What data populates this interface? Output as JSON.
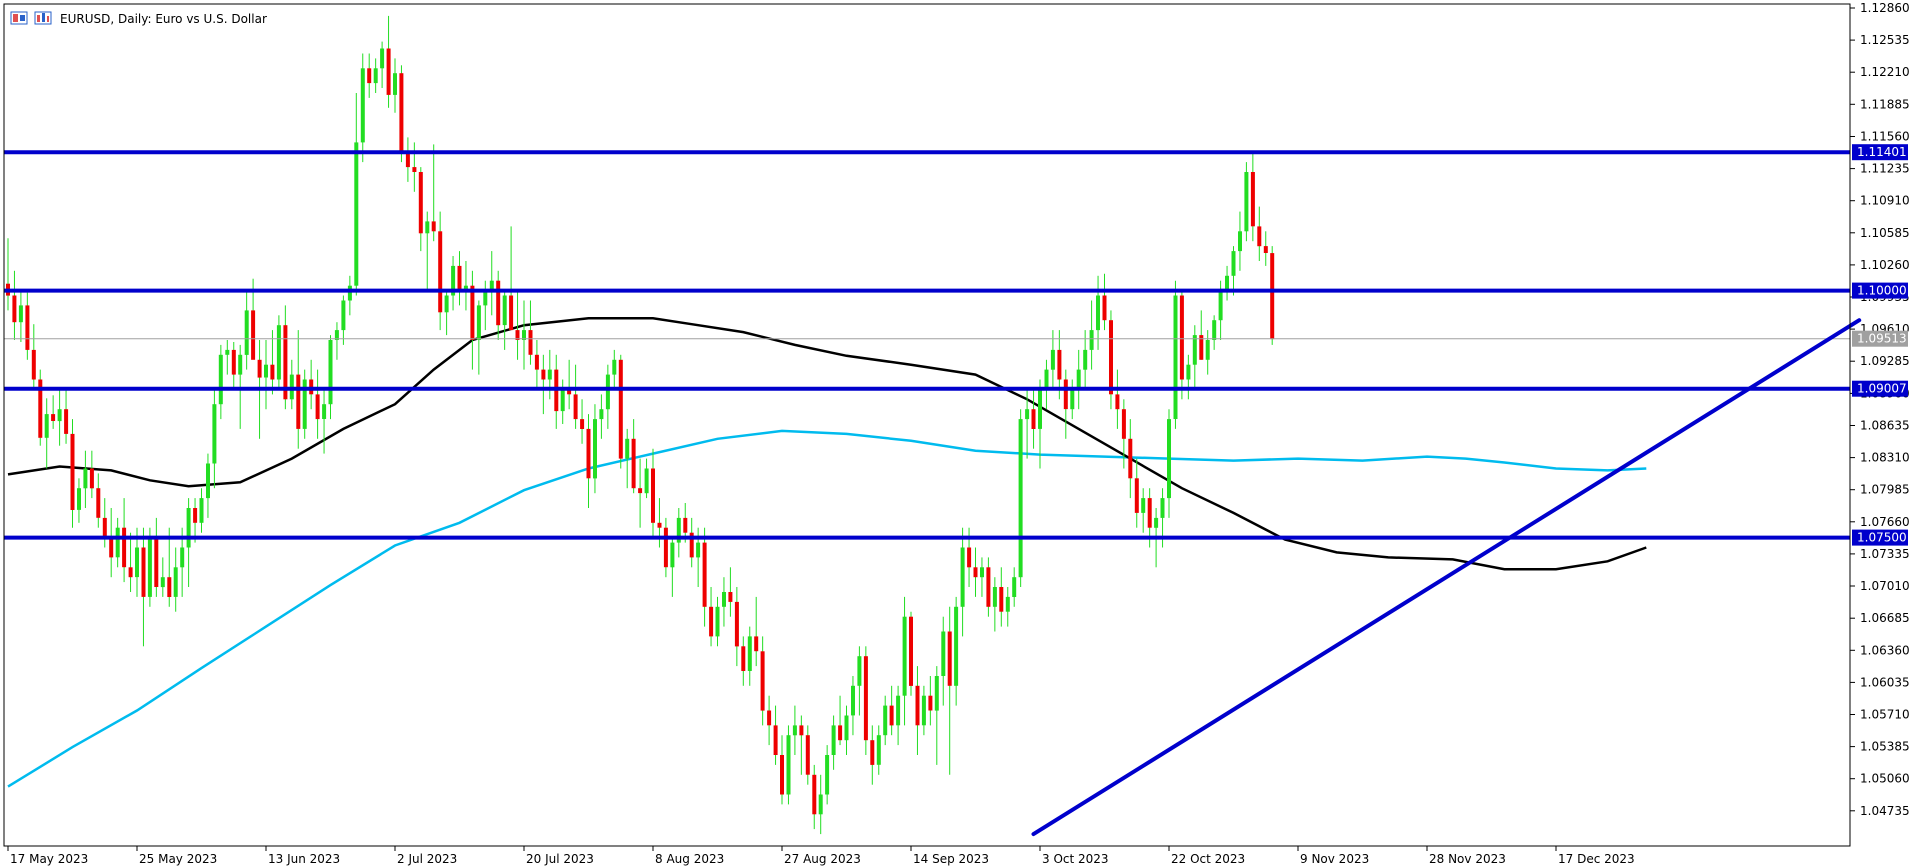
{
  "header": {
    "title": "EURUSD, Daily:  Euro vs U.S. Dollar",
    "icons": [
      "candles-toggle-icon",
      "chart-type-icon"
    ]
  },
  "colors": {
    "bull": "#22dd22",
    "bear": "#ee0000",
    "wick": "#22dd22",
    "level_line": "#0000cc",
    "trend_line": "#0000cc",
    "ma_black": "#000000",
    "ma_blue": "#00bbee",
    "grid_frame": "#000000",
    "current_price_line": "#a0a0a0",
    "current_price_label_bg": "#a0a0a0"
  },
  "chart_data": {
    "type": "candlestick",
    "symbol": "EURUSD",
    "timeframe": "Daily",
    "title": "EURUSD, Daily:  Euro vs U.S. Dollar",
    "ylim": [
      1.0445,
      1.1286
    ],
    "y_ticks": [
      "1.12860",
      "1.12535",
      "1.12210",
      "1.11885",
      "1.11560",
      "1.11235",
      "1.10910",
      "1.10585",
      "1.10260",
      "1.09935",
      "1.09610",
      "1.09285",
      "1.08960",
      "1.08635",
      "1.08310",
      "1.07985",
      "1.07660",
      "1.07335",
      "1.07010",
      "1.06685",
      "1.06360",
      "1.06035",
      "1.05710",
      "1.05385",
      "1.05060",
      "1.04735"
    ],
    "x_ticks": [
      "17 May 2023",
      "25 May 2023",
      "13 Jun 2023",
      "2 Jul 2023",
      "20 Jul 2023",
      "8 Aug 2023",
      "27 Aug 2023",
      "14 Sep 2023",
      "3 Oct 2023",
      "22 Oct 2023",
      "9 Nov 2023",
      "28 Nov 2023",
      "17 Dec 2023"
    ],
    "x_tick_index": [
      0,
      20,
      40,
      60,
      80,
      100,
      120,
      140,
      160,
      180,
      200,
      220,
      240
    ],
    "levels": [
      {
        "value": 1.11401,
        "label": "1.11401"
      },
      {
        "value": 1.1,
        "label": "1.10000"
      },
      {
        "value": 1.09007,
        "label": "1.09007"
      },
      {
        "value": 1.075,
        "label": "1.07500"
      }
    ],
    "current_price": {
      "value": 1.09513,
      "label": "1.09513"
    },
    "trend_line": {
      "from": {
        "index": 159,
        "value": 1.045
      },
      "to": {
        "index": 287,
        "value": 1.097
      }
    },
    "ma_black": [
      [
        0,
        1.0814
      ],
      [
        8,
        1.0822
      ],
      [
        16,
        1.0818
      ],
      [
        22,
        1.0808
      ],
      [
        28,
        1.0802
      ],
      [
        36,
        1.0806
      ],
      [
        44,
        1.083
      ],
      [
        52,
        1.086
      ],
      [
        60,
        1.0885
      ],
      [
        66,
        1.092
      ],
      [
        72,
        1.095
      ],
      [
        80,
        1.0965
      ],
      [
        90,
        1.0972
      ],
      [
        100,
        1.0972
      ],
      [
        106,
        1.0966
      ],
      [
        114,
        1.0958
      ],
      [
        122,
        1.0945
      ],
      [
        130,
        1.0934
      ],
      [
        140,
        1.0925
      ],
      [
        150,
        1.0915
      ],
      [
        158,
        1.089
      ],
      [
        166,
        1.086
      ],
      [
        174,
        1.083
      ],
      [
        182,
        1.08
      ],
      [
        190,
        1.0775
      ],
      [
        198,
        1.0748
      ],
      [
        206,
        1.0735
      ],
      [
        214,
        1.073
      ],
      [
        224,
        1.0728
      ],
      [
        232,
        1.0718
      ],
      [
        240,
        1.0718
      ],
      [
        248,
        1.0726
      ],
      [
        254,
        1.074
      ]
    ],
    "ma_blue": [
      [
        0,
        1.0498
      ],
      [
        10,
        1.0538
      ],
      [
        20,
        1.0575
      ],
      [
        30,
        1.0618
      ],
      [
        40,
        1.066
      ],
      [
        50,
        1.0702
      ],
      [
        60,
        1.0742
      ],
      [
        70,
        1.0765
      ],
      [
        80,
        1.0798
      ],
      [
        90,
        1.082
      ],
      [
        100,
        1.0835
      ],
      [
        110,
        1.085
      ],
      [
        120,
        1.0858
      ],
      [
        130,
        1.0855
      ],
      [
        140,
        1.0848
      ],
      [
        150,
        1.0838
      ],
      [
        160,
        1.0834
      ],
      [
        170,
        1.0832
      ],
      [
        180,
        1.083
      ],
      [
        190,
        1.0828
      ],
      [
        200,
        1.083
      ],
      [
        210,
        1.0828
      ],
      [
        220,
        1.0832
      ],
      [
        226,
        1.083
      ],
      [
        232,
        1.0826
      ],
      [
        240,
        1.082
      ],
      [
        248,
        1.0818
      ],
      [
        254,
        1.082
      ]
    ],
    "ohlc": [
      [
        1.1007,
        1.1053,
        1.098,
        1.0995
      ],
      [
        1.0995,
        1.102,
        1.095,
        1.0968
      ],
      [
        1.0968,
        1.1,
        1.0948,
        1.0985
      ],
      [
        1.0985,
        1.0998,
        1.093,
        1.094
      ],
      [
        1.094,
        1.0966,
        1.09,
        1.091
      ],
      [
        1.091,
        1.092,
        1.0843,
        1.0851
      ],
      [
        1.0851,
        1.0891,
        1.082,
        1.0875
      ],
      [
        1.0875,
        1.0894,
        1.086,
        1.0868
      ],
      [
        1.0868,
        1.09,
        1.0843,
        1.088
      ],
      [
        1.088,
        1.09,
        1.0845,
        1.0855
      ],
      [
        1.0855,
        1.087,
        1.076,
        1.0778
      ],
      [
        1.0778,
        1.081,
        1.0765,
        1.08
      ],
      [
        1.08,
        1.0838,
        1.078,
        1.082
      ],
      [
        1.082,
        1.0838,
        1.079,
        1.08
      ],
      [
        1.08,
        1.0815,
        1.076,
        1.077
      ],
      [
        1.077,
        1.079,
        1.074,
        1.075
      ],
      [
        1.075,
        1.078,
        1.071,
        1.073
      ],
      [
        1.073,
        1.077,
        1.072,
        1.076
      ],
      [
        1.076,
        1.079,
        1.0705,
        1.072
      ],
      [
        1.072,
        1.0755,
        1.0695,
        1.071
      ],
      [
        1.071,
        1.076,
        1.069,
        1.074
      ],
      [
        1.074,
        1.076,
        1.064,
        1.069
      ],
      [
        1.069,
        1.076,
        1.068,
        1.075
      ],
      [
        1.075,
        1.077,
        1.069,
        1.07
      ],
      [
        1.07,
        1.073,
        1.069,
        1.071
      ],
      [
        1.071,
        1.076,
        1.068,
        1.069
      ],
      [
        1.069,
        1.074,
        1.0675,
        1.072
      ],
      [
        1.072,
        1.076,
        1.069,
        1.074
      ],
      [
        1.074,
        1.079,
        1.07,
        1.078
      ],
      [
        1.078,
        1.079,
        1.0745,
        1.0765
      ],
      [
        1.0765,
        1.08,
        1.0755,
        1.079
      ],
      [
        1.079,
        1.0835,
        1.077,
        1.0825
      ],
      [
        1.0825,
        1.09,
        1.08,
        1.0885
      ],
      [
        1.0885,
        1.0945,
        1.087,
        1.0935
      ],
      [
        1.0935,
        1.095,
        1.0915,
        1.094
      ],
      [
        1.094,
        1.0948,
        1.09,
        1.0915
      ],
      [
        1.0915,
        1.0945,
        1.086,
        1.0935
      ],
      [
        1.0935,
        1.1,
        1.092,
        1.098
      ],
      [
        1.098,
        1.1012,
        1.095,
        1.093
      ],
      [
        1.093,
        1.095,
        1.085,
        1.0912
      ],
      [
        1.0912,
        1.095,
        1.088,
        1.0925
      ],
      [
        1.0925,
        1.096,
        1.0895,
        1.091
      ],
      [
        1.091,
        1.0975,
        1.09,
        1.0965
      ],
      [
        1.0965,
        1.0985,
        1.088,
        1.089
      ],
      [
        1.089,
        1.093,
        1.088,
        1.0915
      ],
      [
        1.0915,
        1.096,
        1.084,
        1.086
      ],
      [
        1.086,
        1.092,
        1.085,
        1.091
      ],
      [
        1.091,
        1.093,
        1.088,
        1.0895
      ],
      [
        1.0895,
        1.092,
        1.085,
        1.087
      ],
      [
        1.087,
        1.09,
        1.0835,
        1.0885
      ],
      [
        1.0885,
        1.0955,
        1.087,
        1.095
      ],
      [
        1.095,
        1.0968,
        1.093,
        1.096
      ],
      [
        1.096,
        1.0995,
        1.0945,
        1.099
      ],
      [
        1.099,
        1.1015,
        1.0975,
        1.1005
      ],
      [
        1.1005,
        1.12,
        1.0995,
        1.115
      ],
      [
        1.115,
        1.124,
        1.113,
        1.1225
      ],
      [
        1.1225,
        1.124,
        1.1195,
        1.121
      ],
      [
        1.121,
        1.1235,
        1.12,
        1.1225
      ],
      [
        1.1225,
        1.1252,
        1.1205,
        1.1245
      ],
      [
        1.1245,
        1.1278,
        1.1185,
        1.1198
      ],
      [
        1.1198,
        1.1235,
        1.118,
        1.122
      ],
      [
        1.122,
        1.1228,
        1.113,
        1.114
      ],
      [
        1.114,
        1.1155,
        1.111,
        1.1125
      ],
      [
        1.1125,
        1.115,
        1.11,
        1.112
      ],
      [
        1.112,
        1.1125,
        1.104,
        1.1058
      ],
      [
        1.1058,
        1.108,
        1.1,
        1.107
      ],
      [
        1.107,
        1.1148,
        1.105,
        1.106
      ],
      [
        1.106,
        1.108,
        1.096,
        1.0978
      ],
      [
        1.0978,
        1.1,
        1.0955,
        1.0995
      ],
      [
        1.0995,
        1.1035,
        1.098,
        1.1025
      ],
      [
        1.1025,
        1.104,
        1.0985,
        1.1
      ],
      [
        1.1,
        1.103,
        1.098,
        1.1005
      ],
      [
        1.1005,
        1.102,
        1.092,
        1.095
      ],
      [
        1.095,
        1.099,
        1.0915,
        1.0985
      ],
      [
        1.0985,
        1.101,
        1.096,
        1.1
      ],
      [
        1.1,
        1.104,
        1.0975,
        1.101
      ],
      [
        1.101,
        1.102,
        1.095,
        1.0965
      ],
      [
        1.0965,
        1.1,
        1.094,
        1.0995
      ],
      [
        1.0995,
        1.1065,
        1.096,
        1.096
      ],
      [
        1.096,
        1.1,
        1.093,
        1.095
      ],
      [
        1.095,
        1.099,
        1.092,
        1.096
      ],
      [
        1.096,
        1.099,
        1.0925,
        1.0935
      ],
      [
        1.0935,
        1.095,
        1.09,
        1.092
      ],
      [
        1.092,
        1.0935,
        1.0875,
        1.091
      ],
      [
        1.091,
        1.094,
        1.089,
        1.092
      ],
      [
        1.092,
        1.0935,
        1.086,
        1.0878
      ],
      [
        1.0878,
        1.091,
        1.0865,
        1.09
      ],
      [
        1.09,
        1.093,
        1.088,
        1.0895
      ],
      [
        1.0895,
        1.0925,
        1.086,
        1.087
      ],
      [
        1.087,
        1.089,
        1.0845,
        1.086
      ],
      [
        1.086,
        1.0875,
        1.078,
        1.081
      ],
      [
        1.081,
        1.0885,
        1.0795,
        1.087
      ],
      [
        1.087,
        1.0895,
        1.085,
        1.088
      ],
      [
        1.088,
        1.0925,
        1.086,
        1.0915
      ],
      [
        1.0915,
        1.094,
        1.09,
        1.093
      ],
      [
        1.093,
        1.0935,
        1.082,
        1.083
      ],
      [
        1.083,
        1.086,
        1.08,
        1.085
      ],
      [
        1.085,
        1.087,
        1.0795,
        1.08
      ],
      [
        1.08,
        1.083,
        1.076,
        1.0795
      ],
      [
        1.0795,
        1.083,
        1.079,
        1.082
      ],
      [
        1.082,
        1.084,
        1.075,
        1.0765
      ],
      [
        1.0765,
        1.079,
        1.074,
        1.076
      ],
      [
        1.076,
        1.077,
        1.071,
        1.072
      ],
      [
        1.072,
        1.075,
        1.069,
        1.0745
      ],
      [
        1.0745,
        1.078,
        1.073,
        1.077
      ],
      [
        1.077,
        1.0785,
        1.0745,
        1.0755
      ],
      [
        1.0755,
        1.077,
        1.072,
        1.073
      ],
      [
        1.073,
        1.076,
        1.07,
        1.0745
      ],
      [
        1.0745,
        1.076,
        1.066,
        1.068
      ],
      [
        1.068,
        1.07,
        1.064,
        1.065
      ],
      [
        1.065,
        1.069,
        1.064,
        1.068
      ],
      [
        1.068,
        1.071,
        1.066,
        1.0695
      ],
      [
        1.0695,
        1.072,
        1.067,
        1.0685
      ],
      [
        1.0685,
        1.07,
        1.062,
        1.064
      ],
      [
        1.064,
        1.065,
        1.06,
        1.0615
      ],
      [
        1.0615,
        1.066,
        1.06,
        1.065
      ],
      [
        1.065,
        1.069,
        1.062,
        1.0635
      ],
      [
        1.0635,
        1.065,
        1.056,
        1.0575
      ],
      [
        1.0575,
        1.059,
        1.054,
        1.056
      ],
      [
        1.056,
        1.058,
        1.052,
        1.053
      ],
      [
        1.053,
        1.055,
        1.048,
        1.049
      ],
      [
        1.049,
        1.056,
        1.048,
        1.055
      ],
      [
        1.055,
        1.058,
        1.053,
        1.056
      ],
      [
        1.056,
        1.057,
        1.051,
        1.055
      ],
      [
        1.055,
        1.056,
        1.05,
        1.051
      ],
      [
        1.051,
        1.052,
        1.0455,
        1.047
      ],
      [
        1.047,
        1.051,
        1.045,
        1.049
      ],
      [
        1.049,
        1.054,
        1.048,
        1.053
      ],
      [
        1.053,
        1.057,
        1.0515,
        1.056
      ],
      [
        1.056,
        1.059,
        1.054,
        1.0545
      ],
      [
        1.0545,
        1.058,
        1.053,
        1.057
      ],
      [
        1.057,
        1.061,
        1.055,
        1.06
      ],
      [
        1.06,
        1.064,
        1.057,
        1.063
      ],
      [
        1.063,
        1.064,
        1.053,
        1.0545
      ],
      [
        1.0545,
        1.056,
        1.05,
        1.052
      ],
      [
        1.052,
        1.056,
        1.051,
        1.055
      ],
      [
        1.055,
        1.059,
        1.054,
        1.058
      ],
      [
        1.058,
        1.06,
        1.055,
        1.056
      ],
      [
        1.056,
        1.06,
        1.054,
        1.059
      ],
      [
        1.059,
        1.069,
        1.056,
        1.067
      ],
      [
        1.067,
        1.0675,
        1.059,
        1.06
      ],
      [
        1.06,
        1.062,
        1.053,
        1.056
      ],
      [
        1.056,
        1.06,
        1.055,
        1.059
      ],
      [
        1.059,
        1.061,
        1.056,
        1.0575
      ],
      [
        1.0575,
        1.062,
        1.052,
        1.061
      ],
      [
        1.061,
        1.067,
        1.058,
        1.0655
      ],
      [
        1.0655,
        1.068,
        1.051,
        1.06
      ],
      [
        1.06,
        1.069,
        1.058,
        1.068
      ],
      [
        1.068,
        1.076,
        1.065,
        1.074
      ],
      [
        1.074,
        1.076,
        1.07,
        1.072
      ],
      [
        1.072,
        1.074,
        1.069,
        1.071
      ],
      [
        1.071,
        1.073,
        1.069,
        1.072
      ],
      [
        1.072,
        1.073,
        1.067,
        1.068
      ],
      [
        1.068,
        1.071,
        1.0655,
        1.07
      ],
      [
        1.07,
        1.072,
        1.066,
        1.0675
      ],
      [
        1.0675,
        1.07,
        1.066,
        1.069
      ],
      [
        1.069,
        1.072,
        1.068,
        1.071
      ],
      [
        1.071,
        1.088,
        1.07,
        1.087
      ],
      [
        1.087,
        1.09,
        1.083,
        1.088
      ],
      [
        1.088,
        1.09,
        1.084,
        1.086
      ],
      [
        1.086,
        1.091,
        1.082,
        1.09
      ],
      [
        1.09,
        1.093,
        1.088,
        1.092
      ],
      [
        1.092,
        1.096,
        1.09,
        1.094
      ],
      [
        1.094,
        1.096,
        1.089,
        1.091
      ],
      [
        1.091,
        1.092,
        1.085,
        1.088
      ],
      [
        1.088,
        1.091,
        1.087,
        1.09
      ],
      [
        1.09,
        1.094,
        1.088,
        1.092
      ],
      [
        1.092,
        1.096,
        1.09,
        1.094
      ],
      [
        1.094,
        1.099,
        1.092,
        1.096
      ],
      [
        1.096,
        1.1015,
        1.094,
        1.0995
      ],
      [
        1.0995,
        1.1017,
        1.096,
        1.097
      ],
      [
        1.097,
        1.098,
        1.088,
        1.0895
      ],
      [
        1.0895,
        1.092,
        1.086,
        1.088
      ],
      [
        1.088,
        1.089,
        1.082,
        1.085
      ],
      [
        1.085,
        1.087,
        1.079,
        1.081
      ],
      [
        1.081,
        1.083,
        1.076,
        1.0775
      ],
      [
        1.0775,
        1.08,
        1.0755,
        1.079
      ],
      [
        1.079,
        1.08,
        1.074,
        1.076
      ],
      [
        1.076,
        1.078,
        1.072,
        1.077
      ],
      [
        1.077,
        1.08,
        1.074,
        1.079
      ],
      [
        1.079,
        1.088,
        1.077,
        1.087
      ],
      [
        1.087,
        1.101,
        1.086,
        1.0995
      ],
      [
        1.0995,
        1.1,
        1.089,
        1.091
      ],
      [
        1.091,
        1.0935,
        1.089,
        1.0925
      ],
      [
        1.0925,
        1.0965,
        1.09,
        1.0955
      ],
      [
        1.0955,
        1.098,
        1.093,
        1.093
      ],
      [
        1.093,
        1.096,
        1.0915,
        1.095
      ],
      [
        1.095,
        1.0975,
        1.094,
        1.097
      ],
      [
        1.097,
        1.101,
        1.095,
        1.1
      ],
      [
        1.1,
        1.1025,
        1.099,
        1.1015
      ],
      [
        1.1015,
        1.1045,
        1.0995,
        1.104
      ],
      [
        1.104,
        1.108,
        1.102,
        1.106
      ],
      [
        1.106,
        1.113,
        1.105,
        1.112
      ],
      [
        1.112,
        1.114,
        1.105,
        1.1065
      ],
      [
        1.1065,
        1.1085,
        1.103,
        1.1045
      ],
      [
        1.1045,
        1.106,
        1.1025,
        1.1038
      ],
      [
        1.1038,
        1.1045,
        1.0945,
        1.0951
      ]
    ]
  }
}
